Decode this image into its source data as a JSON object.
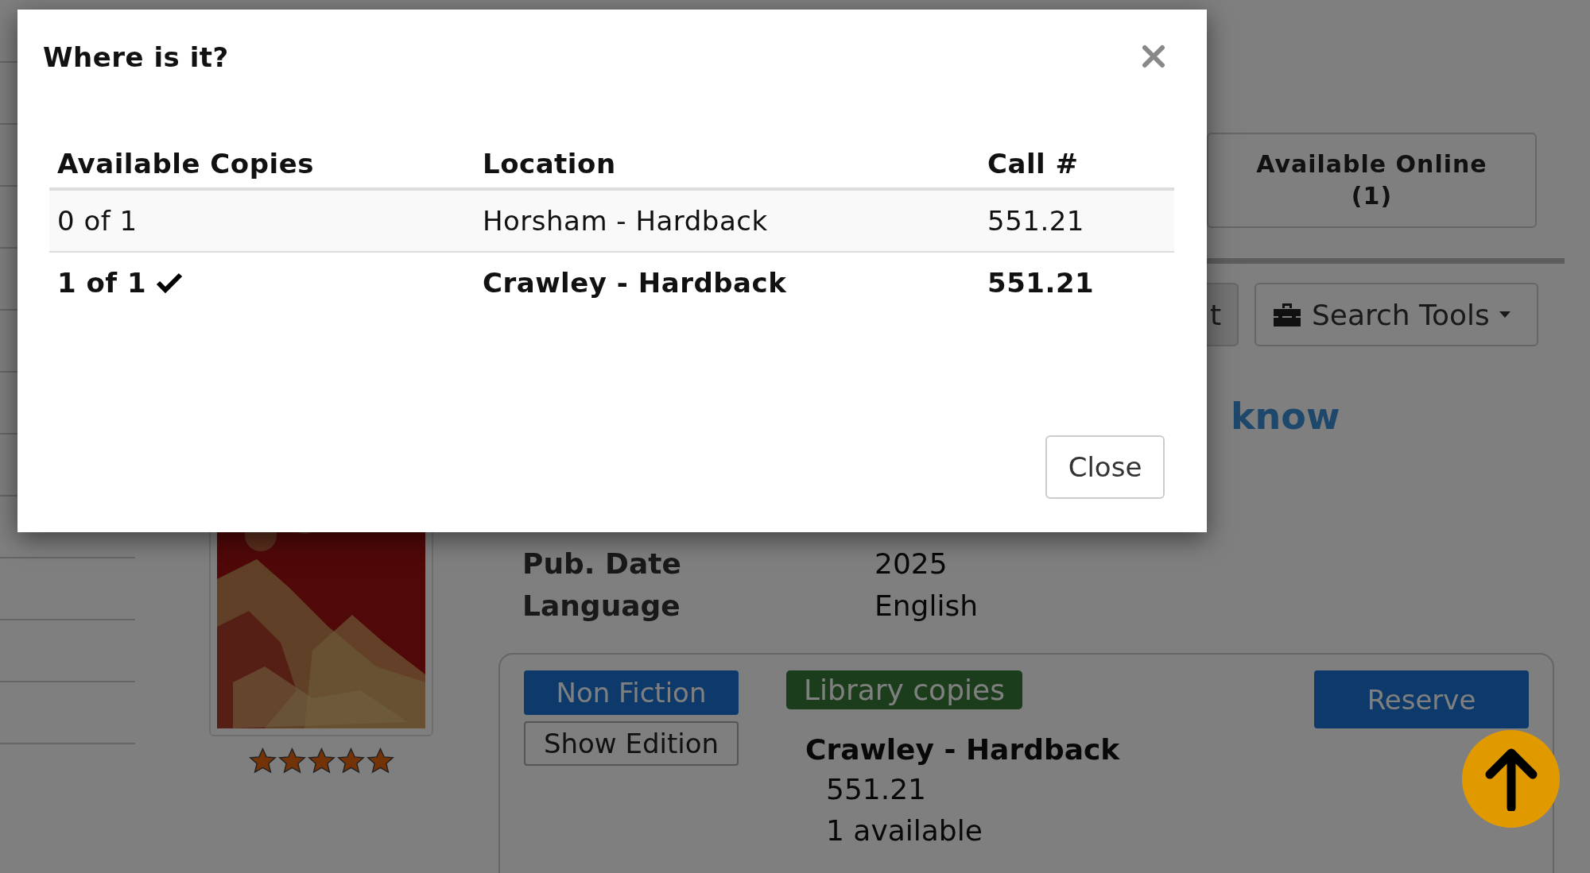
{
  "page": {
    "tabs": [
      {
        "label": "Available Online (1)"
      }
    ],
    "toolbar": [
      {
        "kind": "plain",
        "label": "t"
      },
      {
        "kind": "menu",
        "label": "Search Tools"
      }
    ],
    "heading": "know",
    "rating": {
      "stars": 5
    },
    "details": [
      {
        "label": "Pub. Date",
        "value": "2025"
      },
      {
        "label": "Language",
        "value": "English"
      }
    ],
    "holding": {
      "category": "Non Fiction",
      "show_edition": "Show Edition",
      "badge": "Library copies",
      "action": "Reserve",
      "location": "Crawley - Hardback",
      "call_number": "551.21",
      "availability": "1 available"
    }
  },
  "modal": {
    "title": "Where is it?",
    "columns": [
      "Available Copies",
      "Location",
      "Call #"
    ],
    "rows": [
      {
        "copies": "0 of 1",
        "location": "Horsham - Hardback",
        "call_number": "551.21",
        "available": false
      },
      {
        "copies": "1 of 1",
        "location": "Crawley - Hardback",
        "call_number": "551.21",
        "available": true
      }
    ],
    "buttons": [
      "Close"
    ]
  }
}
